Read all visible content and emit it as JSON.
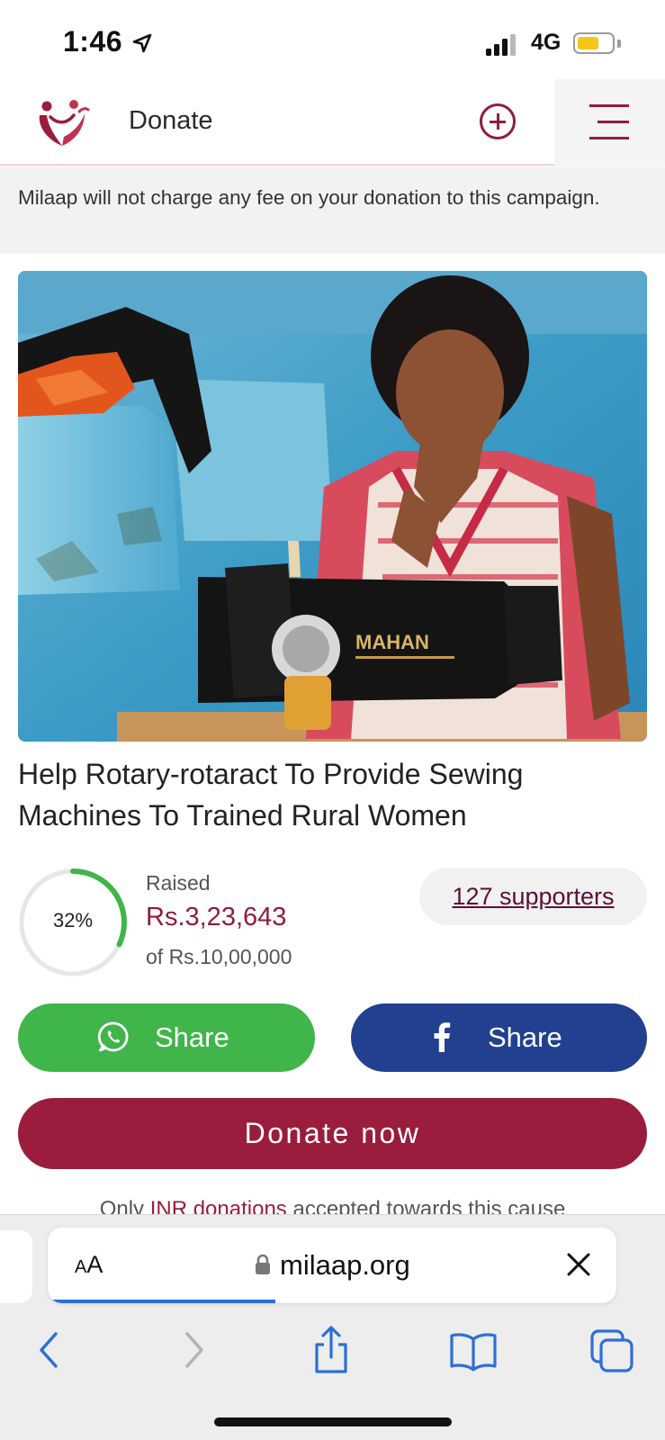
{
  "status_bar": {
    "time": "1:46",
    "network": "4G",
    "battery_level": 0.6,
    "battery_color": "#f5c518"
  },
  "header": {
    "title": "Donate",
    "logo_icon": "milaap-heart-logo-icon",
    "add_icon": "plus-circle-icon",
    "menu_icon": "hamburger-menu-icon",
    "brand_color": "#8f1d3f"
  },
  "notice": {
    "text": "Milaap will not charge any fee on your donation to this campaign."
  },
  "campaign": {
    "image_icon": "woman-sewing-machine-photo",
    "image_brand_text": "MAHAN",
    "title": "Help Rotary-rotaract To Provide Sewing Machines To Trained Rural Women",
    "progress_percent": 32,
    "progress_label": "32%",
    "raised_label": "Raised",
    "raised_amount": "Rs.3,23,643",
    "goal_text": "of Rs.10,00,000",
    "supporters_label": "127 supporters",
    "progress_color": "#3fb54a"
  },
  "actions": {
    "whatsapp_share_label": "Share",
    "whatsapp_icon": "whatsapp-icon",
    "whatsapp_color": "#3fb54a",
    "facebook_share_label": "Share",
    "facebook_icon": "facebook-icon",
    "facebook_color": "#21408f",
    "donate_label": "Donate now",
    "donate_color": "#9a1d3d"
  },
  "footer_note": {
    "prefix": "Only ",
    "link": "INR donations",
    "suffix": " accepted towards this cause"
  },
  "browser": {
    "aa_label_big": "A",
    "aa_label_small": "A",
    "url": "milaap.org",
    "load_progress": 0.4,
    "nav_icons": [
      "back-icon",
      "forward-icon",
      "share-icon",
      "bookmarks-icon",
      "tabs-icon"
    ]
  }
}
